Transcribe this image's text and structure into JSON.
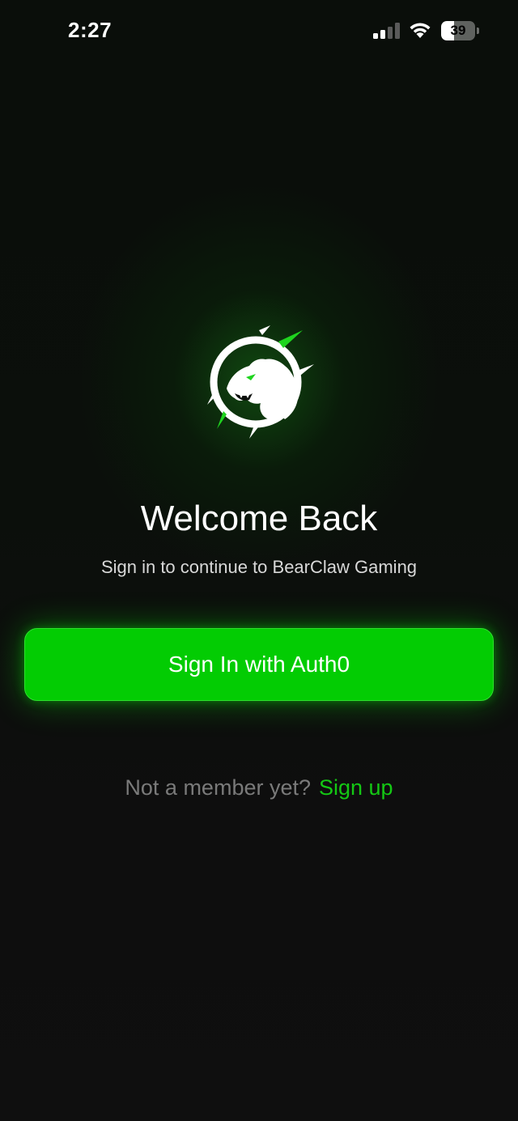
{
  "status_bar": {
    "time": "2:27",
    "battery_level": "39",
    "battery_fraction": 0.39,
    "signal_icon": "cellular-signal-icon",
    "wifi_icon": "wifi-icon"
  },
  "logo": {
    "icon": "bearclaw-logo-icon"
  },
  "welcome": {
    "title": "Welcome Back",
    "subtitle": "Sign in to continue to BearClaw Gaming"
  },
  "signin": {
    "button_label": "Sign In with Auth0"
  },
  "signup": {
    "prompt": "Not a member yet?",
    "link_label": "Sign up"
  },
  "colors": {
    "accent": "#03cc03",
    "link": "#14c814",
    "background": "#0e0e0e"
  }
}
